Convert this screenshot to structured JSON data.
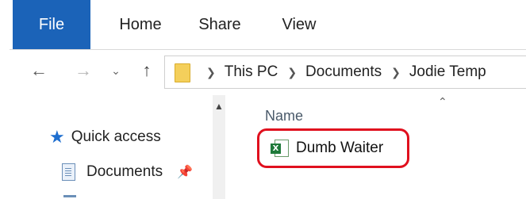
{
  "ribbon": {
    "tabs": [
      {
        "label": "File"
      },
      {
        "label": "Home"
      },
      {
        "label": "Share"
      },
      {
        "label": "View"
      }
    ],
    "file_tab_color": "#1b63b8"
  },
  "nav": {
    "back_icon": "arrow-left-icon",
    "forward_icon": "arrow-right-icon",
    "recent_icon": "chevron-down-icon",
    "up_icon": "arrow-up-icon"
  },
  "address": {
    "crumbs": [
      "This PC",
      "Documents",
      "Jodie Temp"
    ]
  },
  "navpane": {
    "quick_access": "Quick access",
    "documents": "Documents"
  },
  "content": {
    "column_name": "Name",
    "file_label": "Dumb Waiter",
    "file_icon": "excel-icon",
    "highlight_color": "#e0101e"
  }
}
